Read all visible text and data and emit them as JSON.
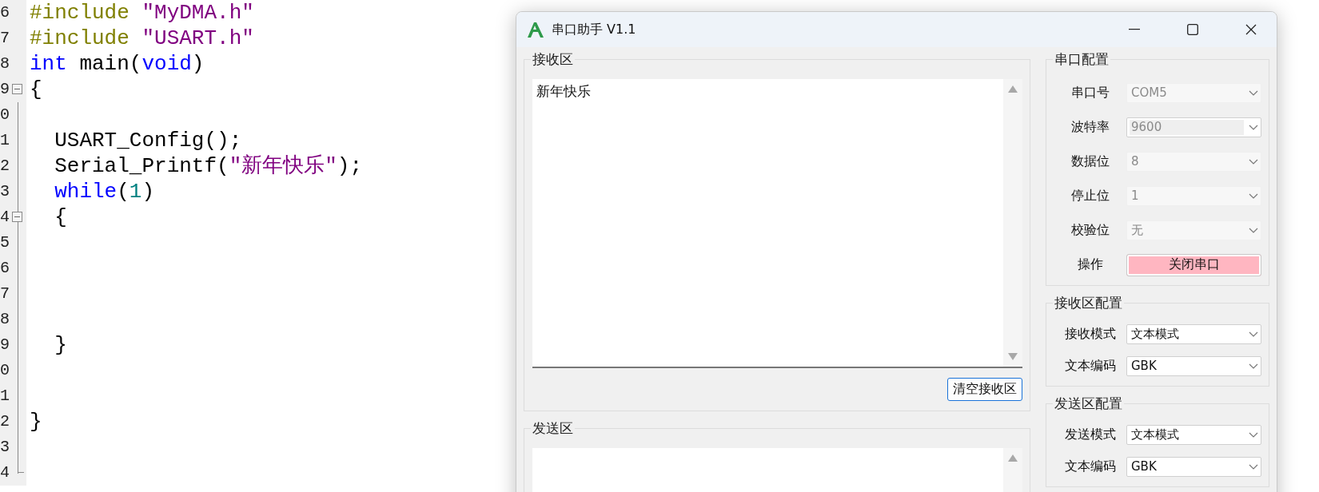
{
  "editor": {
    "lines": [
      {
        "number": "6",
        "tokens": [
          {
            "kind": "directive",
            "text": "#include"
          },
          {
            "kind": "string",
            "text": " \"MyDMA.h\""
          }
        ]
      },
      {
        "number": "7",
        "tokens": [
          {
            "kind": "directive",
            "text": "#include"
          },
          {
            "kind": "string",
            "text": " \"USART.h\""
          }
        ]
      },
      {
        "number": "8",
        "tokens": [
          {
            "kind": "keyword",
            "text": "int"
          },
          {
            "kind": "plain",
            "text": " main("
          },
          {
            "kind": "keyword",
            "text": "void"
          },
          {
            "kind": "plain",
            "text": ")"
          }
        ]
      },
      {
        "number": "9",
        "expanded": true,
        "tokens": [
          {
            "kind": "plain",
            "text": "{"
          }
        ]
      },
      {
        "number": "0"
      },
      {
        "number": "1",
        "tokens": [
          {
            "kind": "plain",
            "text": "  USART_Config();"
          }
        ]
      },
      {
        "number": "2",
        "tokens": [
          {
            "kind": "plain",
            "text": "  Serial_Printf("
          },
          {
            "kind": "string",
            "text": "\"新年快乐\""
          },
          {
            "kind": "plain",
            "text": ");"
          }
        ]
      },
      {
        "number": "3",
        "tokens": [
          {
            "kind": "keyword",
            "text": "  while"
          },
          {
            "kind": "plain",
            "text": "("
          },
          {
            "kind": "number",
            "text": "1"
          },
          {
            "kind": "plain",
            "text": ")"
          }
        ]
      },
      {
        "number": "4",
        "expanded": true,
        "tokens": [
          {
            "kind": "plain",
            "text": "  {"
          }
        ]
      },
      {
        "number": "5"
      },
      {
        "number": "6"
      },
      {
        "number": "7"
      },
      {
        "number": "8"
      },
      {
        "number": "9",
        "tokens": [
          {
            "kind": "plain",
            "text": "  }"
          }
        ]
      },
      {
        "number": "0"
      },
      {
        "number": "1"
      },
      {
        "number": "2",
        "tokens": [
          {
            "kind": "plain",
            "text": "}"
          }
        ]
      },
      {
        "number": "3"
      },
      {
        "number": "4"
      }
    ]
  },
  "window": {
    "title": "串口助手 V1.1"
  },
  "receive_area": {
    "title": "接收区",
    "text": "新年快乐",
    "clear_button": "清空接收区"
  },
  "send_area": {
    "title": "发送区"
  },
  "config_groups": [
    {
      "title": "串口配置",
      "rows": [
        {
          "kind": "combo",
          "label": "串口号",
          "value": "COM5",
          "disabled": true,
          "editable": false
        },
        {
          "kind": "combo",
          "label": "波特率",
          "value": "9600",
          "disabled": true,
          "editable": true
        },
        {
          "kind": "combo",
          "label": "数据位",
          "value": "8",
          "disabled": true,
          "editable": false
        },
        {
          "kind": "combo",
          "label": "停止位",
          "value": "1",
          "disabled": true,
          "editable": false
        },
        {
          "kind": "combo",
          "label": "校验位",
          "value": "无",
          "disabled": true,
          "editable": false
        },
        {
          "kind": "button",
          "label": "操作",
          "value": "关闭串口"
        }
      ]
    },
    {
      "title": "接收区配置",
      "rows": [
        {
          "kind": "combo",
          "label": "接收模式",
          "value": "文本模式",
          "disabled": false,
          "editable": false
        },
        {
          "kind": "combo",
          "label": "文本编码",
          "value": "GBK",
          "disabled": false,
          "editable": false
        }
      ]
    },
    {
      "title": "发送区配置",
      "rows": [
        {
          "kind": "combo",
          "label": "发送模式",
          "value": "文本模式",
          "disabled": false,
          "editable": false
        },
        {
          "kind": "combo",
          "label": "文本编码",
          "value": "GBK",
          "disabled": false,
          "editable": false
        }
      ]
    }
  ]
}
